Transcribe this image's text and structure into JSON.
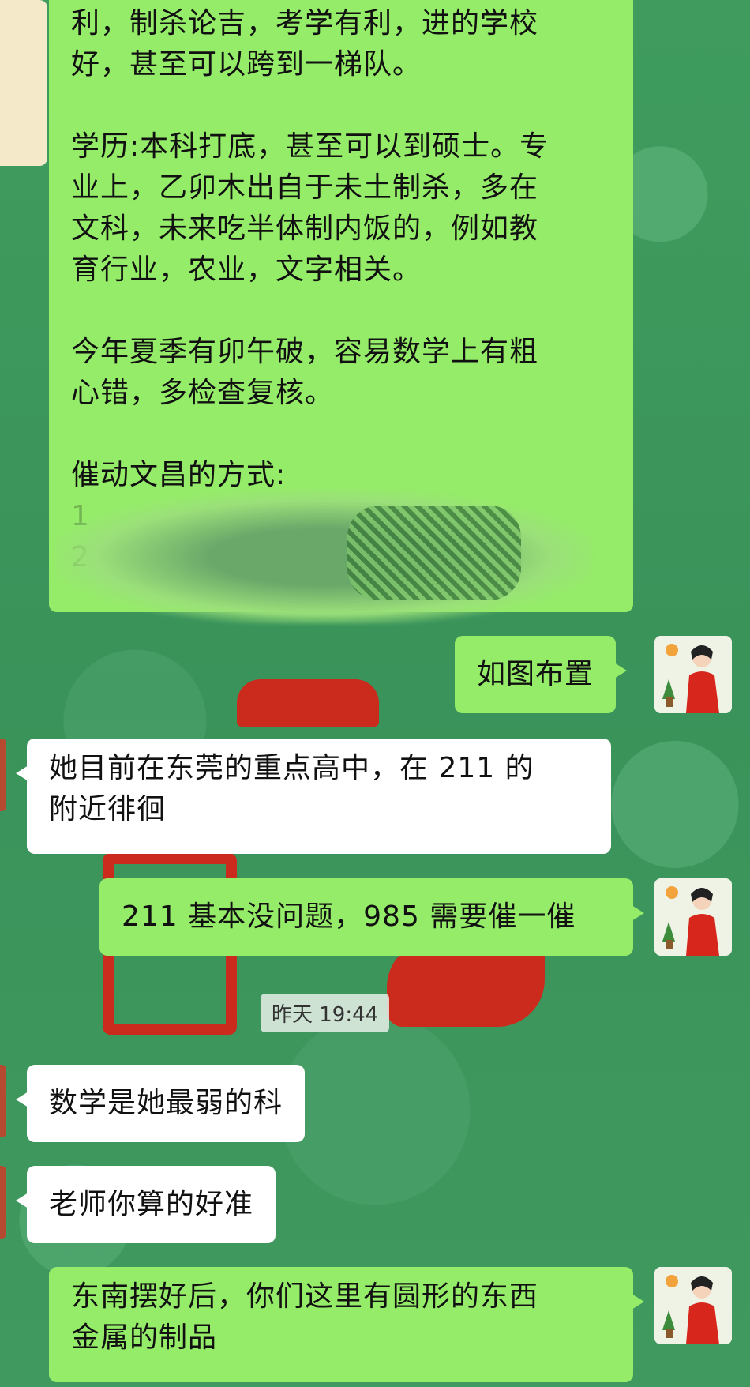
{
  "chat": {
    "first_message": {
      "line1": "利，制杀论吉，考学有利，进的学校",
      "line2": "好，甚至可以跨到一梯队。",
      "para2": [
        "学历:本科打底，甚至可以到硕士。专",
        "业上，乙卯木出自于未土制杀，多在",
        "文科，未来吃半体制内饭的，例如教",
        "育行业，农业，文字相关。"
      ],
      "para3": [
        "今年夏季有卯午破，容易数学上有粗",
        "心错，多检查复核。"
      ],
      "para4": "催动文昌的方式:",
      "list_markers": [
        "1",
        "2"
      ]
    },
    "msg_layout": "如图布置",
    "msg_school": [
      "她目前在东莞的重点高中，在 211 的",
      "附近徘徊"
    ],
    "msg_211": "211 基本没问题，985 需要催一催",
    "timestamp": "昨天  19:44",
    "msg_math": "数学是她最弱的科",
    "msg_accurate": "老师你算的好准",
    "msg_southeast": [
      "东南摆好后，你们这里有圆形的东西",
      "金属的制品"
    ]
  },
  "colors": {
    "sent_bubble": "#95ec69",
    "received_bubble": "#ffffff",
    "background": "#3e9a5c"
  },
  "icons": {
    "avatar_self": "teacher-avatar-icon",
    "avatar_other": "client-avatar-icon"
  }
}
